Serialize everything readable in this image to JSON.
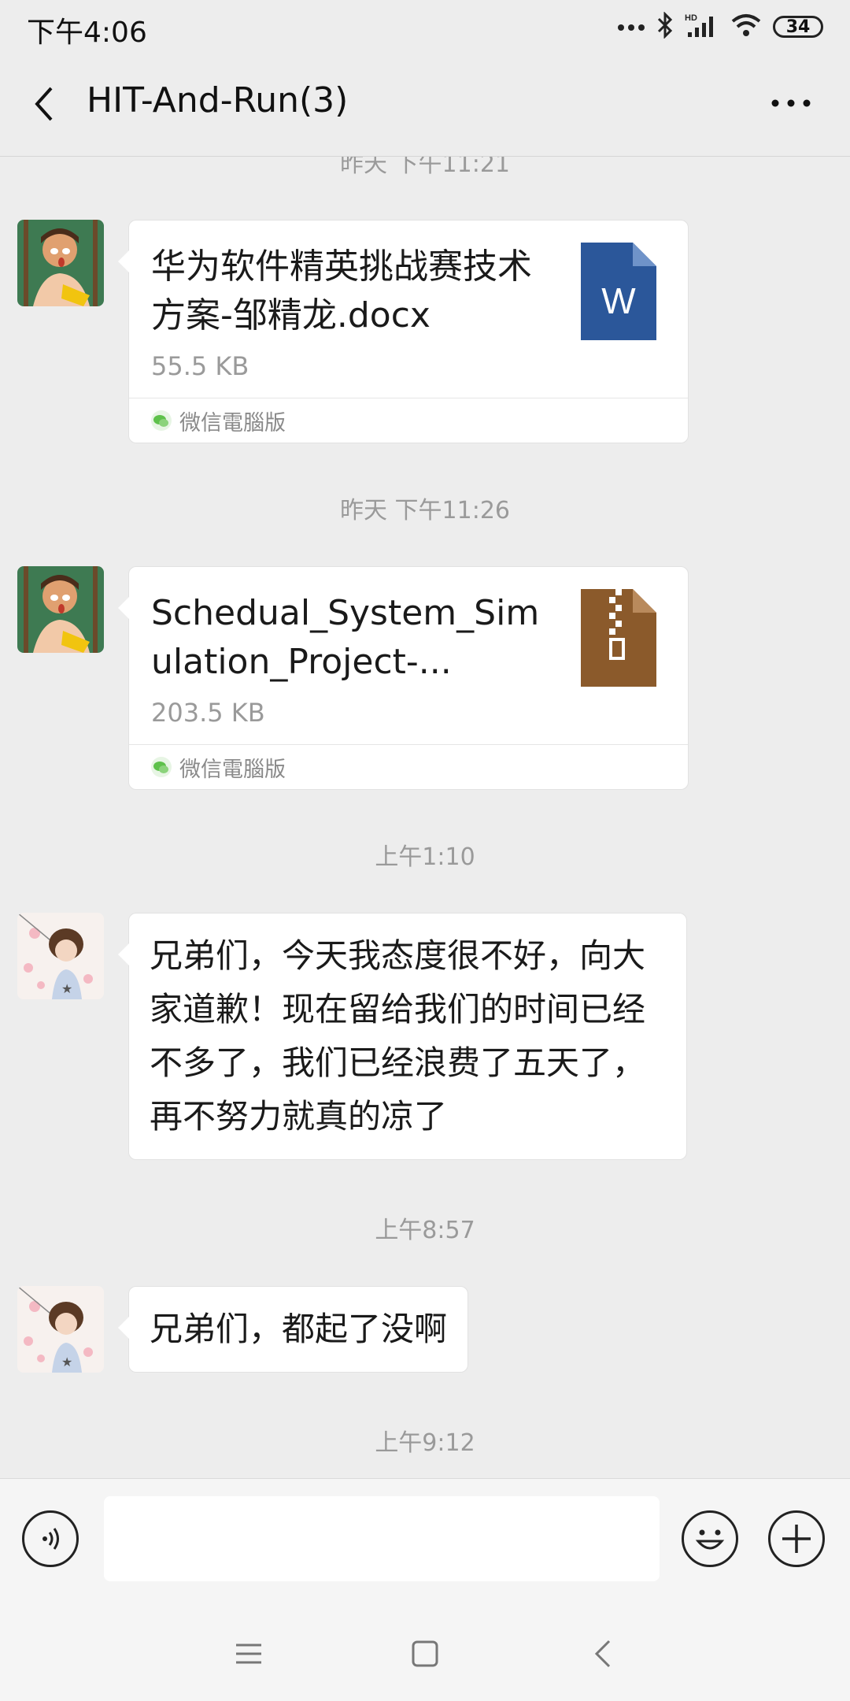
{
  "status_bar": {
    "time": "下午4:06",
    "battery": "34",
    "icons": [
      "more-dots-icon",
      "bluetooth-icon",
      "hd-signal-icon",
      "wifi-icon",
      "battery-icon"
    ]
  },
  "header": {
    "title": "HIT-And-Run(3)",
    "back_icon": "back-chevron-icon",
    "more_icon": "more-dots-icon"
  },
  "chat": {
    "top_timestamp_partial": "昨天 下午11:21",
    "messages": [
      {
        "type": "file",
        "file_name": "华为软件精英挑战赛技术方案-邹精龙.docx",
        "file_size": "55.5 KB",
        "file_icon": "word-doc-icon",
        "source": "微信電腦版",
        "icon_color": "#2b579a"
      },
      {
        "type": "timestamp",
        "text": "昨天 下午11:26"
      },
      {
        "type": "file",
        "file_name": "Schedual_System_Simulation_Project-...",
        "file_size": "203.5 KB",
        "file_icon": "zip-archive-icon",
        "source": "微信電腦版",
        "icon_color": "#8b5a2b"
      },
      {
        "type": "timestamp",
        "text": "上午1:10"
      },
      {
        "type": "text",
        "text": "兄弟们，今天我态度很不好，向大家道歉！现在留给我们的时间已经不多了，我们已经浪费了五天了，再不努力就真的凉了"
      },
      {
        "type": "timestamp",
        "text": "上午8:57"
      },
      {
        "type": "text",
        "text": "兄弟们，都起了没啊"
      },
      {
        "type": "timestamp",
        "text": "上午9:12"
      }
    ]
  },
  "input_bar": {
    "voice_icon": "voice-input-icon",
    "emoji_icon": "emoji-icon",
    "plus_icon": "plus-icon",
    "placeholder": ""
  },
  "nav_bar": {
    "menu_icon": "menu-icon",
    "home_icon": "home-square-icon",
    "back_icon": "nav-back-icon"
  }
}
